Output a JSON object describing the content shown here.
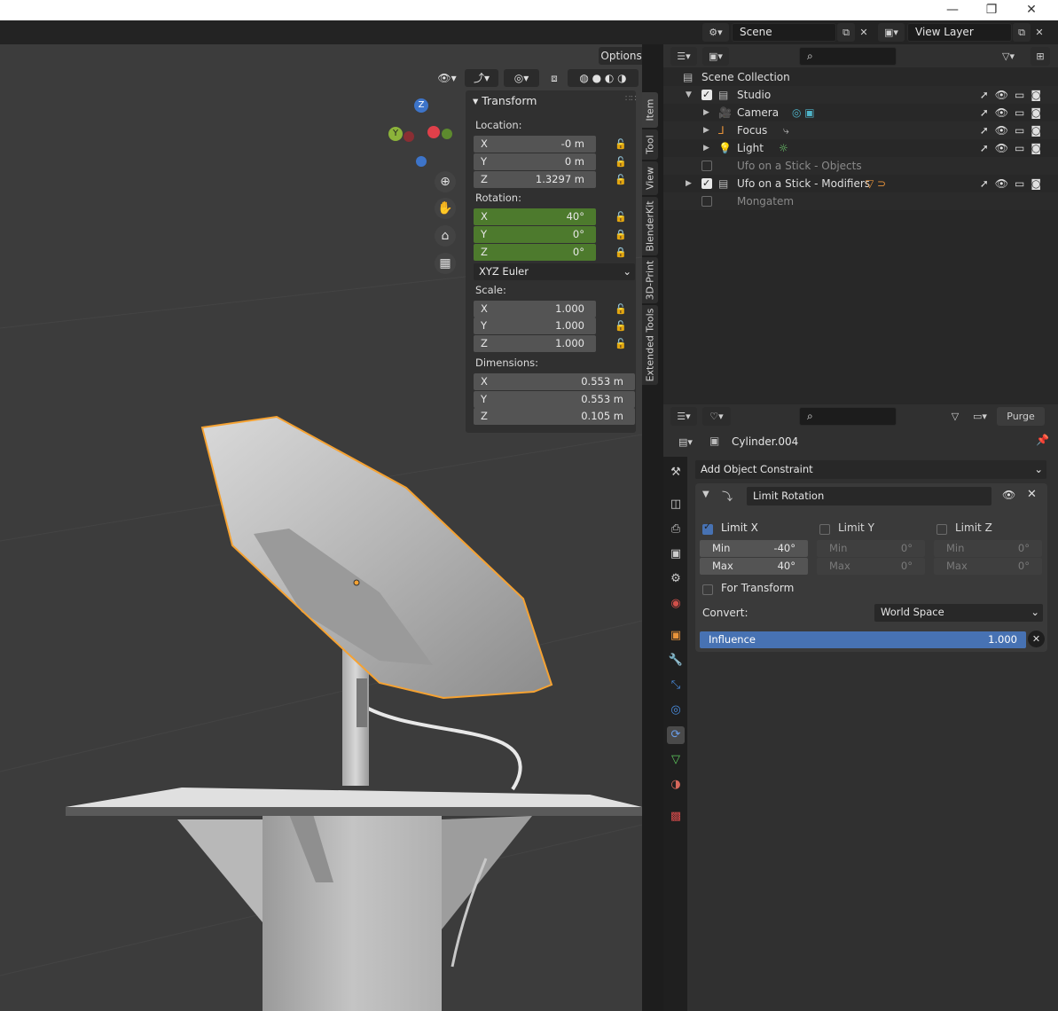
{
  "window": {
    "minimize_glyph": "—",
    "maximize_glyph": "❐",
    "close_glyph": "✕"
  },
  "top_header": {
    "scene_label": "Scene",
    "view_layer_label": "View Layer"
  },
  "viewport": {
    "options_label": "Options",
    "gizmo": {
      "z": "Z",
      "y": "Y"
    }
  },
  "npanel": {
    "panel_title": "Transform",
    "location": {
      "label": "Location:",
      "x_axis": "X",
      "x": "-0 m",
      "y_axis": "Y",
      "y": "0 m",
      "z_axis": "Z",
      "z": "1.3297 m"
    },
    "rotation": {
      "label": "Rotation:",
      "x_axis": "X",
      "x": "40°",
      "y_axis": "Y",
      "y": "0°",
      "z_axis": "Z",
      "z": "0°"
    },
    "rotation_mode": "XYZ Euler",
    "scale": {
      "label": "Scale:",
      "x_axis": "X",
      "x": "1.000",
      "y_axis": "Y",
      "y": "1.000",
      "z_axis": "Z",
      "z": "1.000"
    },
    "dimensions": {
      "label": "Dimensions:",
      "x_axis": "X",
      "x": "0.553 m",
      "y_axis": "Y",
      "y": "0.553 m",
      "z_axis": "Z",
      "z": "0.105 m"
    },
    "tabs": [
      "Item",
      "Tool",
      "View",
      "BlenderKit",
      "3D-Print",
      "Extended Tools"
    ]
  },
  "outliner": {
    "items": [
      {
        "name": "Scene Collection"
      },
      {
        "name": "Studio"
      },
      {
        "name": "Camera"
      },
      {
        "name": "Focus"
      },
      {
        "name": "Light"
      },
      {
        "name": "Ufo on a Stick - Objects"
      },
      {
        "name": "Ufo on a Stick - Modifiers"
      },
      {
        "name": "Mongatem"
      }
    ]
  },
  "properties": {
    "purge_label": "Purge",
    "object_name": "Cylinder.004",
    "add_constraint_label": "Add Object Constraint",
    "constraint": {
      "name": "Limit Rotation",
      "limit_x": {
        "label": "Limit X",
        "enabled": true,
        "min_label": "Min",
        "min": "-40°",
        "max_label": "Max",
        "max": "40°"
      },
      "limit_y": {
        "label": "Limit Y",
        "enabled": false,
        "min_label": "Min",
        "min": "0°",
        "max_label": "Max",
        "max": "0°"
      },
      "limit_z": {
        "label": "Limit Z",
        "enabled": false,
        "min_label": "Min",
        "min": "0°",
        "max_label": "Max",
        "max": "0°"
      },
      "for_transform_label": "For Transform",
      "convert_label": "Convert:",
      "convert_value": "World Space",
      "influence_label": "Influence",
      "influence_value": "1.000"
    }
  },
  "colors": {
    "accent_blue": "#4772b3",
    "selection_orange": "#f5a232",
    "rotation_green": "#4d7a2d"
  }
}
